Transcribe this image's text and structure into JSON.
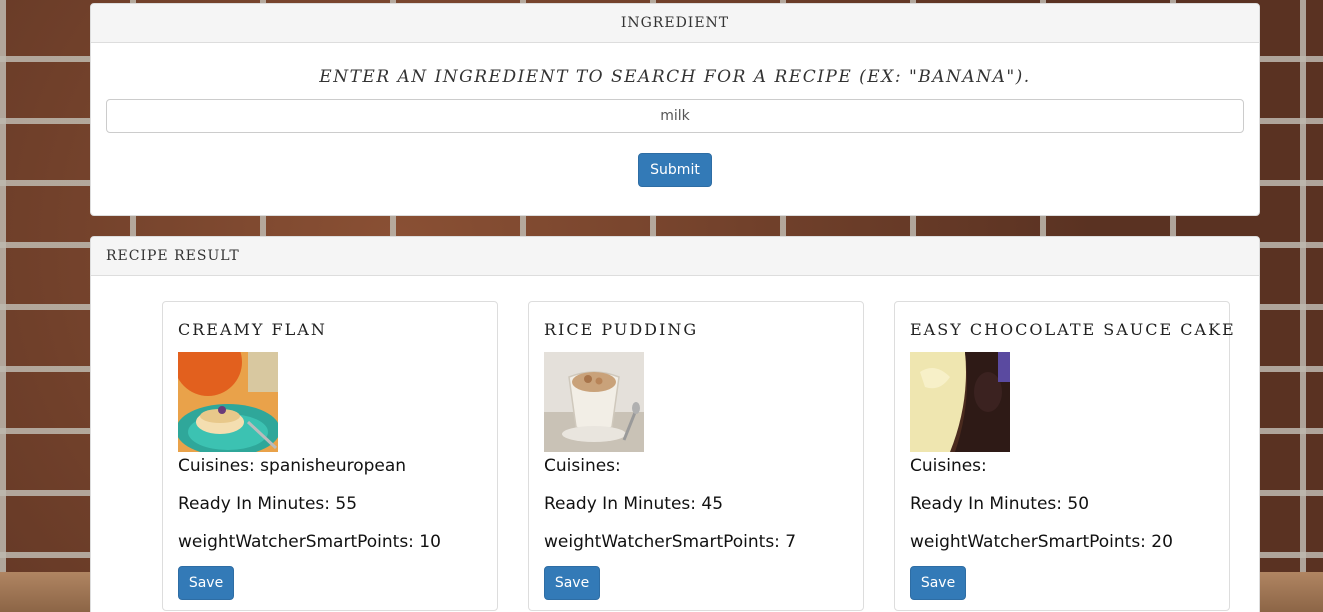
{
  "ingredient_panel": {
    "heading": "INGREDIENT",
    "prompt": "ENTER AN INGREDIENT TO SEARCH FOR A RECIPE (EX: \"BANANA\").",
    "input_value": "milk",
    "submit_label": "Submit"
  },
  "result_panel": {
    "heading": "RECIPE RESULT",
    "recipes": [
      {
        "title": "CREAMY FLAN",
        "cuisines": "Cuisines: spanisheuropean",
        "ready": "Ready In Minutes: 55",
        "points": "weightWatcherSmartPoints: 10",
        "save_label": "Save"
      },
      {
        "title": "RICE PUDDING",
        "cuisines": "Cuisines:",
        "ready": "Ready In Minutes: 45",
        "points": "weightWatcherSmartPoints: 7",
        "save_label": "Save"
      },
      {
        "title": "EASY CHOCOLATE SAUCE CAKE",
        "cuisines": "Cuisines:",
        "ready": "Ready In Minutes: 50",
        "points": "weightWatcherSmartPoints: 20",
        "save_label": "Save"
      }
    ]
  },
  "colors": {
    "button": "#337ab7",
    "panel_heading_bg": "#f5f5f5"
  }
}
